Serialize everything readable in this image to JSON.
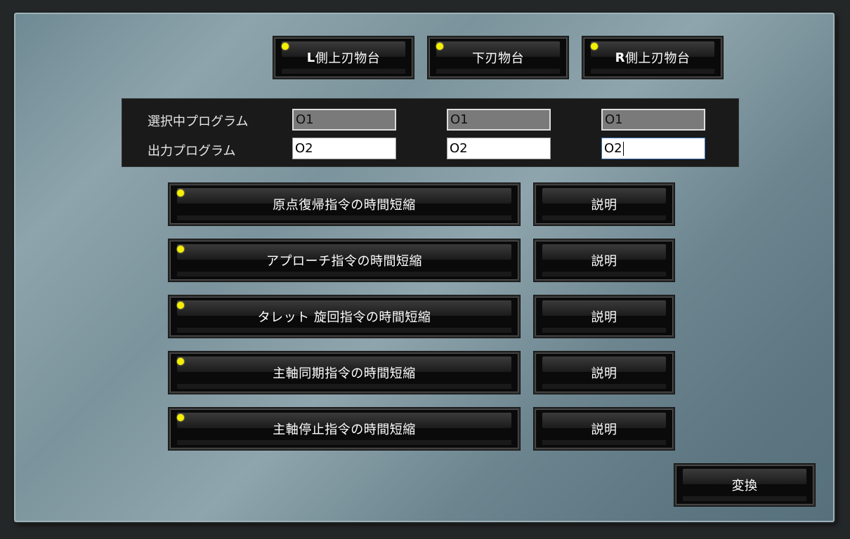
{
  "tabs": [
    {
      "prefix": "L",
      "rest": "側上刃物台"
    },
    {
      "prefix": "",
      "rest": "下刃物台"
    },
    {
      "prefix": "R",
      "rest": "側上刃物台"
    }
  ],
  "program": {
    "selected_label": "選択中プログラム",
    "output_label": "出力プログラム",
    "selected_values": [
      "O1",
      "O1",
      "O1"
    ],
    "output_values": [
      "O2",
      "O2",
      "O2"
    ]
  },
  "commands": [
    {
      "label": "原点復帰指令の時間短縮",
      "help": "説明"
    },
    {
      "label": "アプローチ指令の時間短縮",
      "help": "説明"
    },
    {
      "label": "タレット 旋回指令の時間短縮",
      "help": "説明"
    },
    {
      "label": "主軸同期指令の時間短縮",
      "help": "説明"
    },
    {
      "label": "主軸停止指令の時間短縮",
      "help": "説明"
    }
  ],
  "convert_label": "変換",
  "colors": {
    "led": "#f5f000",
    "button_bg": "#0a0a0a",
    "panel": "#7d949d"
  }
}
